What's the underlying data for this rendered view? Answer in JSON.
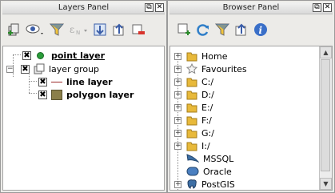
{
  "layers_panel": {
    "title": "Layers Panel",
    "toolbar_icons": [
      "add-group-icon",
      "eye-visibility-icon",
      "filter-icon",
      "filter-expression-icon",
      "expand-all-icon",
      "collapse-all-icon",
      "remove-layer-icon"
    ],
    "items": [
      {
        "label": "point layer",
        "checked": true,
        "bold": true,
        "underline": true
      },
      {
        "label": "layer group",
        "checked": true,
        "bold": false
      },
      {
        "label": "line layer",
        "checked": true,
        "bold": true
      },
      {
        "label": "polygon layer",
        "checked": true,
        "bold": true
      }
    ]
  },
  "browser_panel": {
    "title": "Browser Panel",
    "toolbar_icons": [
      "add-selected-layers-icon",
      "refresh-icon",
      "filter-icon",
      "collapse-all-icon",
      "info-icon"
    ],
    "items": [
      {
        "label": "Home",
        "icon": "folder-icon"
      },
      {
        "label": "Favourites",
        "icon": "star-icon"
      },
      {
        "label": "C:/",
        "icon": "folder-icon"
      },
      {
        "label": "D:/",
        "icon": "folder-icon"
      },
      {
        "label": "E:/",
        "icon": "folder-icon"
      },
      {
        "label": "F:/",
        "icon": "folder-icon"
      },
      {
        "label": "G:/",
        "icon": "folder-icon"
      },
      {
        "label": "I:/",
        "icon": "folder-icon"
      },
      {
        "label": "MSSQL",
        "icon": "mssql-icon"
      },
      {
        "label": "Oracle",
        "icon": "oracle-icon"
      },
      {
        "label": "PostGIS",
        "icon": "postgis-icon"
      }
    ]
  },
  "colors": {
    "point_symbol": "#2a9d3a",
    "line_symbol": "#9c2a2a",
    "polygon_fill": "#8b7f4a",
    "folder": "#e8b93a",
    "db_blue": "#3d6fa5"
  }
}
